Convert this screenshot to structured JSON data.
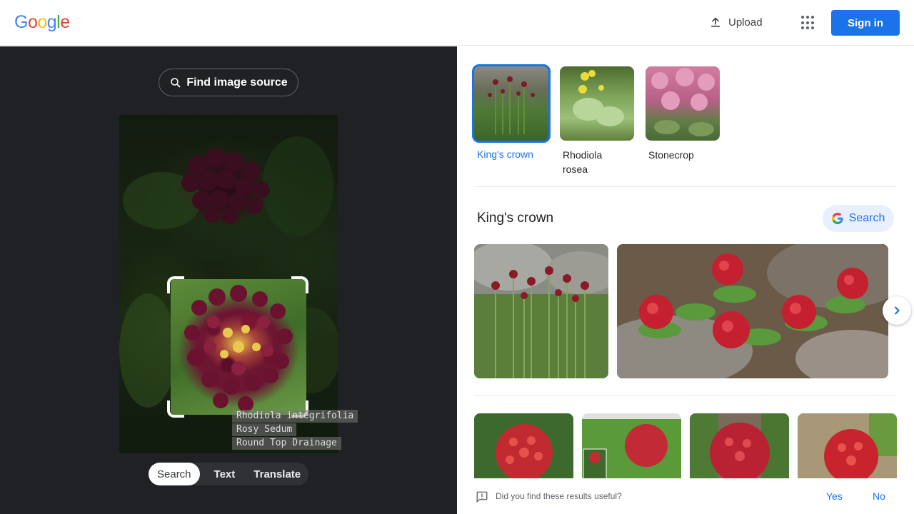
{
  "header": {
    "logo_letters": [
      {
        "ch": "G",
        "color": "#4285F4"
      },
      {
        "ch": "o",
        "color": "#EA4335"
      },
      {
        "ch": "o",
        "color": "#FBBC05"
      },
      {
        "ch": "g",
        "color": "#4285F4"
      },
      {
        "ch": "l",
        "color": "#34A853"
      },
      {
        "ch": "e",
        "color": "#EA4335"
      }
    ],
    "upload_label": "Upload",
    "apps_icon": "apps-grid-icon",
    "signin_label": "Sign in"
  },
  "left": {
    "find_source_label": "Find image source",
    "watermark_lines": [
      "Rhodiola integrifolia",
      "Rosy Sedum",
      "Round Top Drainage"
    ],
    "modes": [
      "Search",
      "Text",
      "Translate"
    ],
    "active_mode": "Search"
  },
  "right": {
    "suggestions": [
      {
        "label": "King's crown",
        "selected": true
      },
      {
        "label": "Rhodiola rosea",
        "selected": false
      },
      {
        "label": "Stonecrop",
        "selected": false
      }
    ],
    "section_title": "King's crown",
    "search_button_label": "Search",
    "feedback": {
      "question": "Did you find these results useful?",
      "yes": "Yes",
      "no": "No"
    }
  },
  "colors": {
    "accent": "#1a73e8",
    "dark_panel": "#202124"
  }
}
